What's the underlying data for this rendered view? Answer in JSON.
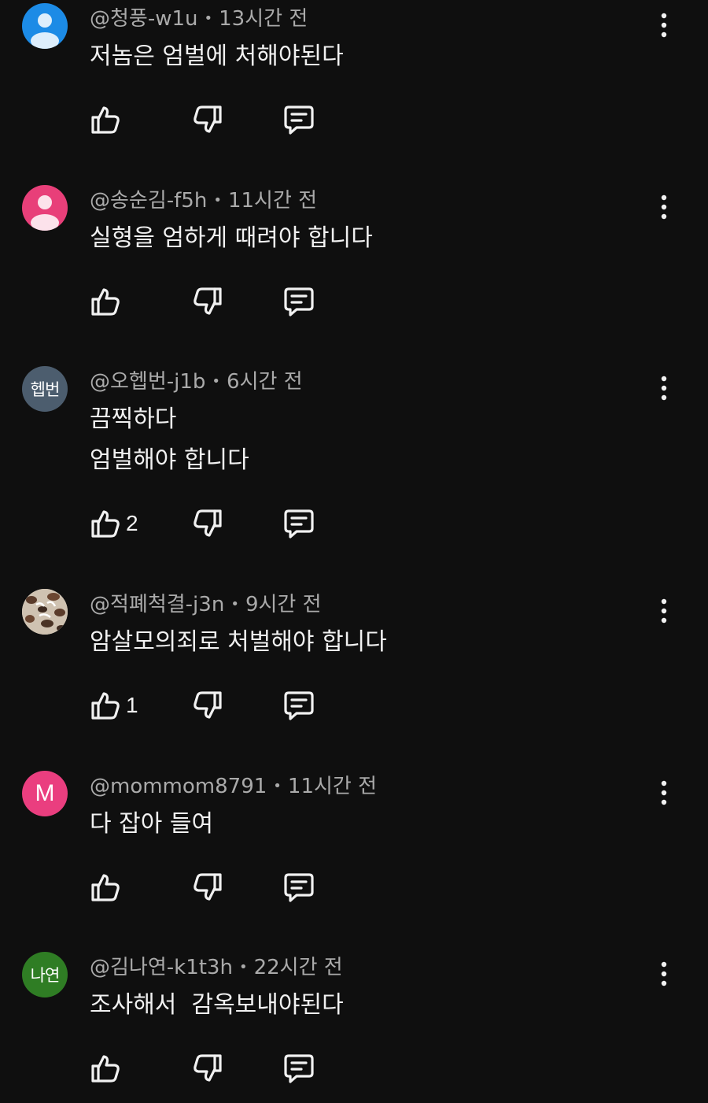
{
  "comments": [
    {
      "handle": "@청풍-w1u",
      "time": "13시간 전",
      "lines": [
        "저놈은 엄벌에 처해야된다"
      ],
      "likes": "",
      "avatar": {
        "type": "default",
        "color": "#1c8be6"
      }
    },
    {
      "handle": "@송순김-f5h",
      "time": "11시간 전",
      "lines": [
        "실형을 엄하게 때려야 합니다"
      ],
      "likes": "",
      "avatar": {
        "type": "default",
        "color": "#e83f79"
      }
    },
    {
      "handle": "@오헵번-j1b",
      "time": "6시간 전",
      "lines": [
        "끔찍하다",
        "엄벌해야 합니다"
      ],
      "likes": "2",
      "avatar": {
        "type": "text",
        "text": "헵번",
        "color": "#4c5d6e"
      }
    },
    {
      "handle": "@적폐척결-j3n",
      "time": "9시간 전",
      "lines": [
        "암살모의죄로 처벌해야 합니다"
      ],
      "likes": "1",
      "avatar": {
        "type": "image",
        "color": "#8a7560"
      }
    },
    {
      "handle": "@mommom8791",
      "time": "11시간 전",
      "lines": [
        "다 잡아 들여"
      ],
      "likes": "",
      "avatar": {
        "type": "letter",
        "text": "M",
        "color": "#ea3e7f"
      }
    },
    {
      "handle": "@김나연-k1t3h",
      "time": "22시간 전",
      "lines": [
        "조사해서  감옥보내야된다"
      ],
      "likes": "",
      "avatar": {
        "type": "text",
        "text": "나연",
        "color": "#2f7d24"
      }
    }
  ],
  "icons": {
    "like": "thumbs-up-icon",
    "dislike": "thumbs-down-icon",
    "reply": "reply-icon",
    "more": "more-vert-icon"
  },
  "colors": {
    "background": "#0f0f0f",
    "text": "#f1f1f1",
    "meta": "#aaaaaa"
  }
}
